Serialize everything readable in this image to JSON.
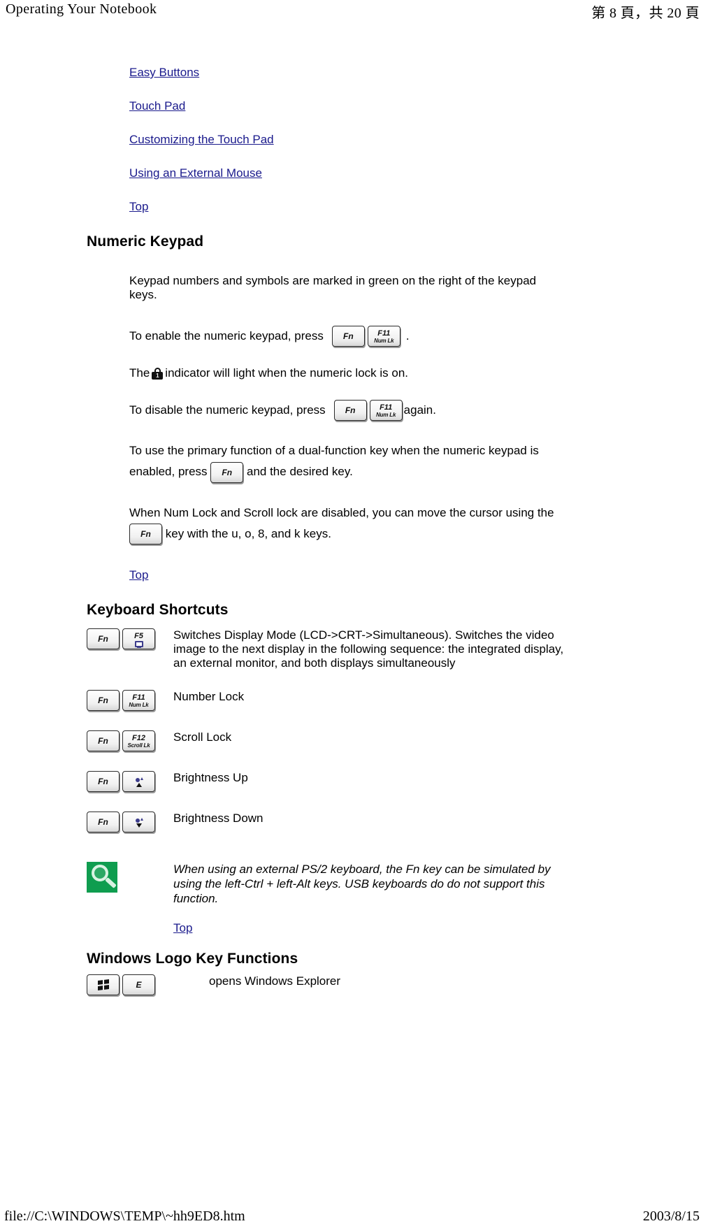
{
  "page_header": {
    "title": "Operating Your Notebook",
    "page_indicator": "第 8 頁，共 20 頁"
  },
  "page_footer": {
    "file_path": "file://C:\\WINDOWS\\TEMP\\~hh9ED8.htm",
    "date": "2003/8/15"
  },
  "toc": {
    "links": [
      {
        "label": "Easy Buttons"
      },
      {
        "label": "Touch Pad"
      },
      {
        "label": "Customizing the Touch Pad"
      },
      {
        "label": "Using an External Mouse"
      },
      {
        "label": "Top"
      }
    ]
  },
  "numeric_keypad": {
    "heading": "Numeric Keypad",
    "p1": "Keypad numbers and symbols are marked in green on the right of the keypad keys.",
    "p2_before": "To enable the numeric keypad, press",
    "p2_after": ".",
    "p3_before": "The",
    "p3_after": "indicator will light when the numeric lock is on.",
    "p3_icon": "lock-icon",
    "p4_before": "To disable the numeric keypad, press",
    "p4_after": "again.",
    "p5_before": "To use the primary function of a dual-function key when the numeric keypad is enabled, press",
    "p5_after": "and the desired key.",
    "p6_before": "When Num Lock and Scroll lock are disabled, you can move the cursor using the",
    "p6_after": "key with the u, o, 8, and k keys.",
    "top_link": "Top"
  },
  "keys": {
    "fn": "Fn",
    "f5_top": "F5",
    "f11_top": "F11",
    "f11_bot": "Num Lk",
    "f12_top": "F12",
    "f12_bot": "Scroll Lk",
    "letter_e": "E"
  },
  "keyboard_shortcuts": {
    "heading": "Keyboard Shortcuts",
    "rows": [
      {
        "keys": "Fn + F5",
        "description": "Switches Display Mode (LCD->CRT->Simultaneous). Switches the video image to the next display in the following sequence: the integrated display, an external monitor, and both displays simultaneously"
      },
      {
        "keys": "Fn + F11 (Num Lk)",
        "description": "Number Lock"
      },
      {
        "keys": "Fn + F12 (Scroll Lk)",
        "description": "Scroll Lock"
      },
      {
        "keys": "Fn + Brightness Up",
        "description": "Brightness Up"
      },
      {
        "keys": "Fn + Brightness Down",
        "description": "Brightness Down"
      }
    ],
    "note": "When using an external PS/2 keyboard, the Fn key can be simulated by using the left-Ctrl + left-Alt keys. USB keyboards do do not support this function.",
    "note_icon": "magnifier-note-icon",
    "top_link": "Top"
  },
  "windows_logo_key": {
    "heading": "Windows Logo Key Functions",
    "rows": [
      {
        "keys": "Windows Logo + E",
        "description": "opens Windows Explorer"
      }
    ]
  },
  "colors": {
    "link": "#1a1a8c",
    "note_badge_green": "#0f9d4f",
    "key_glyph_blue": "#3c3c8c",
    "text": "#000000"
  }
}
